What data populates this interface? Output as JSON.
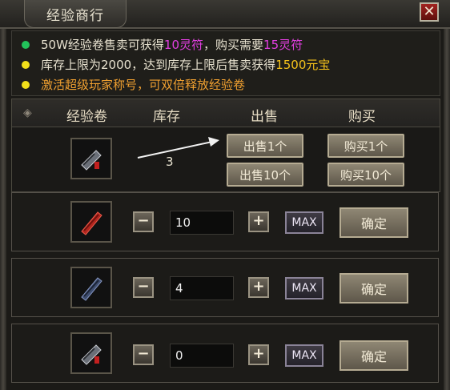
{
  "window": {
    "title": "经验商行",
    "close_label": "✕"
  },
  "info": [
    {
      "dot_color": "#22c25a",
      "parts": [
        {
          "text": "50W经验卷售卖可获得",
          "c": ""
        },
        {
          "text": "10灵符",
          "c": "purple"
        },
        {
          "text": "，购买需要",
          "c": ""
        },
        {
          "text": "15灵符",
          "c": "purple"
        }
      ]
    },
    {
      "dot_color": "#f2e01a",
      "parts": [
        {
          "text": "库存上限为2000，达到库存上限后售卖获得",
          "c": ""
        },
        {
          "text": "1500元宝",
          "c": "gold"
        }
      ]
    },
    {
      "dot_color": "#f2e01a",
      "parts": [
        {
          "text": "激活超级玩家称号，可双倍释放经验卷",
          "c": "orange"
        }
      ]
    }
  ],
  "table": {
    "headers": [
      "经验卷",
      "库存",
      "出售",
      "购买"
    ],
    "stock": "3",
    "sell_buttons": [
      "出售1个",
      "出售10个"
    ],
    "buy_buttons": [
      "购买1个",
      "购买10个"
    ]
  },
  "rows": [
    {
      "qty": "10",
      "item_color": "red",
      "max_label": "MAX",
      "confirm_label": "确定",
      "minus": "−",
      "plus": "+"
    },
    {
      "qty": "4",
      "item_color": "blue",
      "max_label": "MAX",
      "confirm_label": "确定",
      "minus": "−",
      "plus": "+"
    },
    {
      "qty": "0",
      "item_color": "gray",
      "max_label": "MAX",
      "confirm_label": "确定",
      "minus": "−",
      "plus": "+"
    }
  ]
}
